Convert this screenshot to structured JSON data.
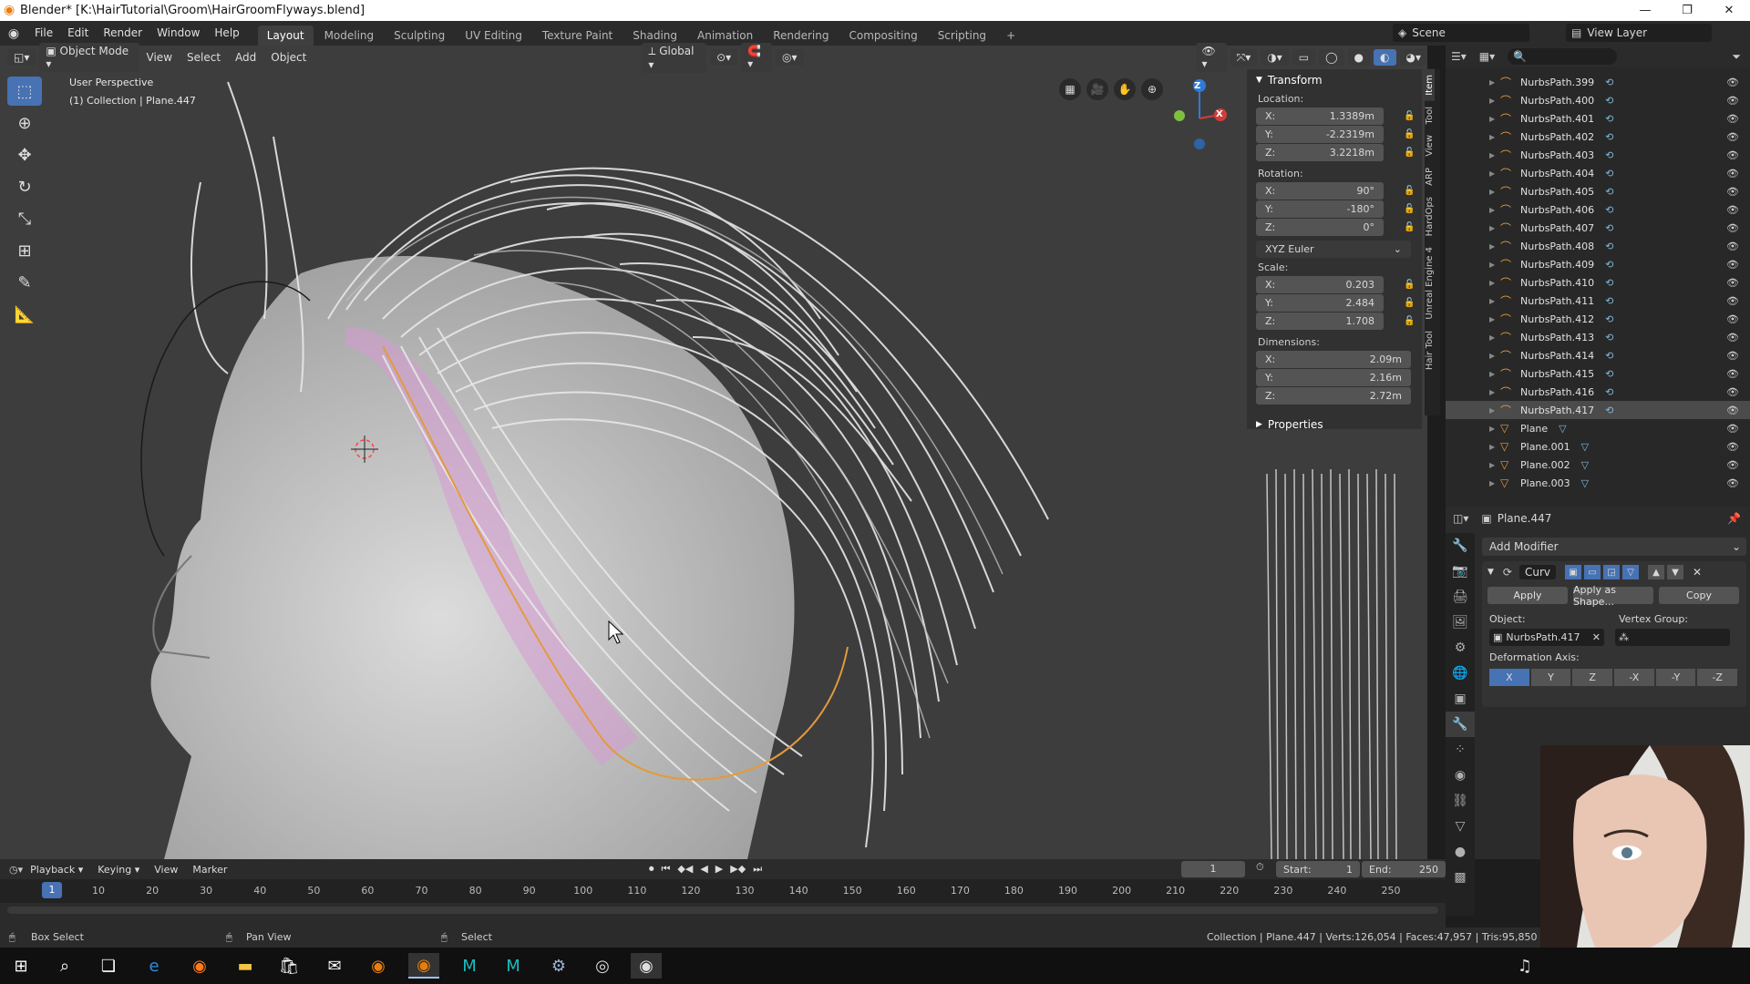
{
  "window": {
    "title": "Blender* [K:\\HairTutorial\\Groom\\HairGroomFlyways.blend]",
    "controls": [
      "—",
      "❐",
      "✕"
    ]
  },
  "menubar": {
    "items": [
      "File",
      "Edit",
      "Render",
      "Window",
      "Help"
    ],
    "workspaces": [
      "Layout",
      "Modeling",
      "Sculpting",
      "UV Editing",
      "Texture Paint",
      "Shading",
      "Animation",
      "Rendering",
      "Compositing",
      "Scripting"
    ],
    "active_workspace": "Layout",
    "add_workspace": "+",
    "scene_label": "Scene",
    "view_layer_label": "View Layer"
  },
  "viewport_header": {
    "mode": "Object Mode",
    "menus": [
      "View",
      "Select",
      "Add",
      "Object"
    ],
    "orientation": "Global"
  },
  "viewport": {
    "perspective_label": "User Perspective",
    "collection_label": "(1) Collection | Plane.447",
    "gizmo_axes": [
      "Z",
      "X",
      "Y"
    ]
  },
  "toolbar": {
    "tools": [
      "select-box",
      "cursor",
      "move",
      "rotate",
      "scale",
      "transform",
      "annotate",
      "measure"
    ]
  },
  "npanel": {
    "transform_header": "Transform",
    "location_label": "Location:",
    "location": {
      "x": "1.3389m",
      "y": "-2.2319m",
      "z": "3.2218m"
    },
    "rotation_label": "Rotation:",
    "rotation": {
      "x": "90°",
      "y": "-180°",
      "z": "0°"
    },
    "rotation_mode": "XYZ Euler",
    "scale_label": "Scale:",
    "scale": {
      "x": "0.203",
      "y": "2.484",
      "z": "1.708"
    },
    "dimensions_label": "Dimensions:",
    "dimensions": {
      "x": "2.09m",
      "y": "2.16m",
      "z": "2.72m"
    },
    "properties_header": "Properties",
    "axis_letters": {
      "x": "X:",
      "y": "Y:",
      "z": "Z:"
    },
    "side_tabs": [
      "Item",
      "Tool",
      "View",
      "ARP",
      "HardOps",
      "Unreal Engine 4",
      "Hair Tool"
    ]
  },
  "outliner": {
    "items": [
      {
        "name": "NurbsPath.399",
        "type": "curve"
      },
      {
        "name": "NurbsPath.400",
        "type": "curve"
      },
      {
        "name": "NurbsPath.401",
        "type": "curve"
      },
      {
        "name": "NurbsPath.402",
        "type": "curve"
      },
      {
        "name": "NurbsPath.403",
        "type": "curve"
      },
      {
        "name": "NurbsPath.404",
        "type": "curve"
      },
      {
        "name": "NurbsPath.405",
        "type": "curve"
      },
      {
        "name": "NurbsPath.406",
        "type": "curve"
      },
      {
        "name": "NurbsPath.407",
        "type": "curve"
      },
      {
        "name": "NurbsPath.408",
        "type": "curve"
      },
      {
        "name": "NurbsPath.409",
        "type": "curve"
      },
      {
        "name": "NurbsPath.410",
        "type": "curve"
      },
      {
        "name": "NurbsPath.411",
        "type": "curve"
      },
      {
        "name": "NurbsPath.412",
        "type": "curve"
      },
      {
        "name": "NurbsPath.413",
        "type": "curve"
      },
      {
        "name": "NurbsPath.414",
        "type": "curve"
      },
      {
        "name": "NurbsPath.415",
        "type": "curve"
      },
      {
        "name": "NurbsPath.416",
        "type": "curve"
      },
      {
        "name": "NurbsPath.417",
        "type": "curve",
        "selected": true
      },
      {
        "name": "Plane",
        "type": "mesh"
      },
      {
        "name": "Plane.001",
        "type": "mesh"
      },
      {
        "name": "Plane.002",
        "type": "mesh"
      },
      {
        "name": "Plane.003",
        "type": "mesh"
      }
    ]
  },
  "properties": {
    "object_name": "Plane.447",
    "add_modifier": "Add Modifier",
    "modifier_name": "Curv",
    "apply": "Apply",
    "apply_as_shape": "Apply as Shape...",
    "copy": "Copy",
    "object_label": "Object:",
    "object_value": "NurbsPath.417",
    "vertex_group_label": "Vertex Group:",
    "deformation_axis_label": "Deformation Axis:",
    "axes": [
      "X",
      "Y",
      "Z",
      "-X",
      "-Y",
      "-Z"
    ],
    "active_axis": "X"
  },
  "timeline": {
    "menus": [
      "Playback",
      "Keying",
      "View",
      "Marker"
    ],
    "current_frame": "1",
    "start_label": "Start:",
    "start": "1",
    "end_label": "End:",
    "end": "250",
    "ticks": [
      "10",
      "20",
      "30",
      "40",
      "50",
      "60",
      "70",
      "80",
      "90",
      "100",
      "110",
      "120",
      "130",
      "140",
      "150",
      "160",
      "170",
      "180",
      "190",
      "200",
      "210",
      "220",
      "230",
      "240",
      "250"
    ],
    "playhead": "1"
  },
  "statusbar": {
    "left1": "Box Select",
    "left2": "Pan View",
    "left3": "Select",
    "stats": "Collection | Plane.447 | Verts:126,054 | Faces:47,957 | Tris:95,850 | Obj"
  },
  "colors": {
    "accent": "#4772b3",
    "curve_icon": "#e39a3c",
    "selected_row": "#4b4b4b"
  }
}
